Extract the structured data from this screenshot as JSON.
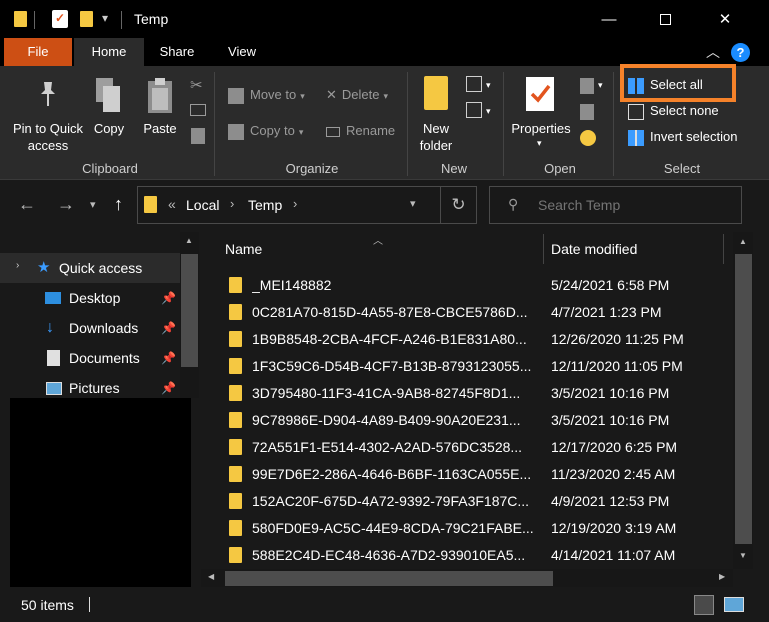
{
  "window": {
    "title": "Temp",
    "minimize": "—",
    "maximize": "☐",
    "close": "✕"
  },
  "quick_access_toolbar": {
    "dropdown": "▾"
  },
  "ribbon_tabs": [
    "File",
    "Home",
    "Share",
    "View"
  ],
  "ribbon": {
    "clipboard": {
      "pin_label_1": "Pin to Quick",
      "pin_label_2": "access",
      "copy": "Copy",
      "paste": "Paste",
      "group": "Clipboard"
    },
    "organize": {
      "move_to": "Move to",
      "copy_to": "Copy to",
      "delete": "Delete",
      "rename": "Rename",
      "group": "Organize"
    },
    "new": {
      "new_folder_1": "New",
      "new_folder_2": "folder",
      "group": "New"
    },
    "open": {
      "properties": "Properties",
      "group": "Open"
    },
    "select": {
      "select_all": "Select all",
      "select_none": "Select none",
      "invert_selection": "Invert selection",
      "group": "Select"
    }
  },
  "address": {
    "overflow": "«",
    "crumbs": [
      "Local",
      "Temp"
    ],
    "search_placeholder": "Search Temp"
  },
  "nav_pane": {
    "quick_access": "Quick access",
    "items": [
      {
        "label": "Desktop",
        "icon": "desktop-icon"
      },
      {
        "label": "Downloads",
        "icon": "downloads-icon"
      },
      {
        "label": "Documents",
        "icon": "documents-icon"
      },
      {
        "label": "Pictures",
        "icon": "pictures-icon"
      }
    ]
  },
  "file_list": {
    "columns": {
      "name": "Name",
      "date": "Date modified"
    },
    "rows": [
      {
        "name": "_MEI148882",
        "date": "5/24/2021 6:58 PM"
      },
      {
        "name": "0C281A70-815D-4A55-87E8-CBCE5786D...",
        "date": "4/7/2021 1:23 PM"
      },
      {
        "name": "1B9B8548-2CBA-4FCF-A246-B1E831A80...",
        "date": "12/26/2020 11:25 PM"
      },
      {
        "name": "1F3C59C6-D54B-4CF7-B13B-8793123055...",
        "date": "12/11/2020 11:05 PM"
      },
      {
        "name": "3D795480-11F3-41CA-9AB8-82745F8D1...",
        "date": "3/5/2021 10:16 PM"
      },
      {
        "name": "9C78986E-D904-4A89-B409-90A20E231...",
        "date": "3/5/2021 10:16 PM"
      },
      {
        "name": "72A551F1-E514-4302-A2AD-576DC3528...",
        "date": "12/17/2020 6:25 PM"
      },
      {
        "name": "99E7D6E2-286A-4646-B6BF-1163CA055E...",
        "date": "11/23/2020 2:45 AM"
      },
      {
        "name": "152AC20F-675D-4A72-9392-79FA3F187C...",
        "date": "4/9/2021 12:53 PM"
      },
      {
        "name": "580FD0E9-AC5C-44E9-8CDA-79C21FABE...",
        "date": "12/19/2020 3:19 AM"
      },
      {
        "name": "588E2C4D-EC48-4636-A7D2-939010EA5...",
        "date": "4/14/2021 11:07 AM"
      }
    ]
  },
  "status_bar": {
    "item_count": "50 items"
  },
  "colors": {
    "file_tab": "#cd4f14",
    "highlight": "#f5822a",
    "folder": "#f5c842",
    "accent_blue": "#1a8cff"
  }
}
